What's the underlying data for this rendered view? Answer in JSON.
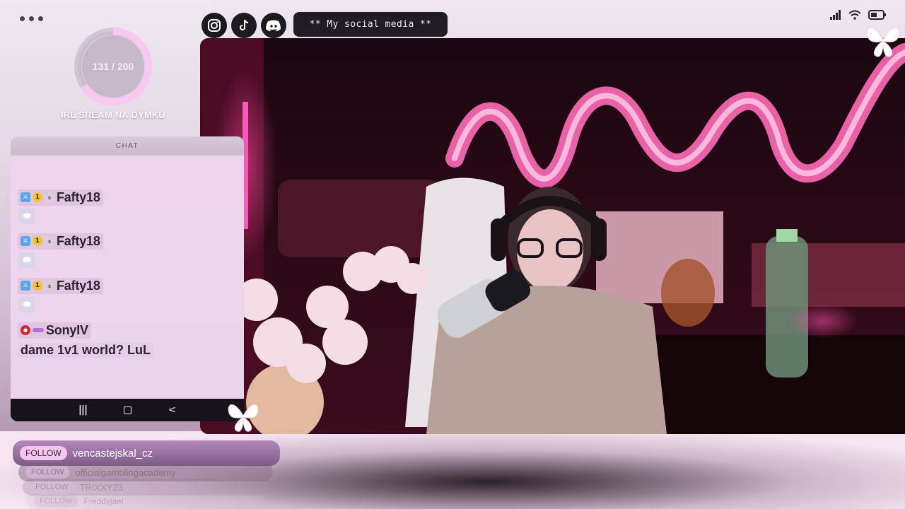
{
  "goal": {
    "current_label": "131 / 200",
    "current": 131,
    "target": 200,
    "title": "IRL SREAM NA DÝMKU"
  },
  "chat": {
    "header": "CHAT",
    "messages": [
      {
        "user": "Fafty18",
        "emote": true
      },
      {
        "user": "Fafty18",
        "emote": true
      },
      {
        "user": "Fafty18",
        "emote": true
      },
      {
        "user": "SonyIV",
        "text": "dame 1v1 world? LuL"
      }
    ],
    "nav": {
      "recent": "|||",
      "home": "",
      "back": "<"
    }
  },
  "socials": {
    "icons": [
      "instagram-icon",
      "tiktok-icon",
      "discord-icon"
    ],
    "label": "** My social media **"
  },
  "follows": [
    {
      "tag": "FOLLOW",
      "name": "vencastejskal_cz"
    },
    {
      "tag": "FOLLOW",
      "name": "officialgamblingacademy"
    },
    {
      "tag": "FOLLOW",
      "name": "TRIXXY23"
    },
    {
      "tag": "FOLLOW",
      "name": "Freddyjael"
    }
  ],
  "colors": {
    "accent_pink": "#f5c4ef",
    "neon": "#ff4fa8",
    "dark": "#1d1a1f"
  }
}
